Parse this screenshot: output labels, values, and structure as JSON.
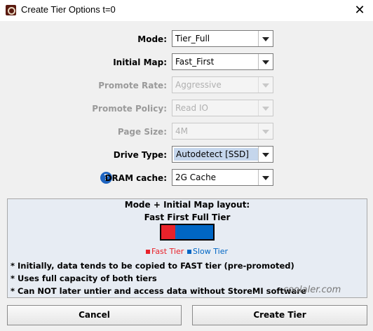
{
  "window": {
    "title": "Create Tier Options t=0",
    "close_glyph": "✕"
  },
  "form": {
    "mode": {
      "label": "Mode:",
      "value": "Tier_Full"
    },
    "initial_map": {
      "label": "Initial Map:",
      "value": "Fast_First"
    },
    "promote_rate": {
      "label": "Promote Rate:",
      "value": "Aggressive"
    },
    "promote_policy": {
      "label": "Promote Policy:",
      "value": "Read IO"
    },
    "page_size": {
      "label": "Page Size:",
      "value": "4M"
    },
    "drive_type": {
      "label": "Drive Type:",
      "value": "Autodetect [SSD]"
    },
    "dram_cache": {
      "label": "DRAM cache:",
      "value": "2G Cache",
      "help_glyph": "?"
    }
  },
  "layout_panel": {
    "heading": "Mode + Initial Map layout:",
    "subheading": "Fast First Full Tier",
    "legend_fast": "Fast Tier",
    "legend_slow": "Slow Tier",
    "notes": [
      "* Initially, data tends to be copied to FAST tier (pre-promoted)",
      "* Uses full capacity of both tiers",
      "* Can NOT later untier and access data without StoreMI software"
    ]
  },
  "buttons": {
    "cancel": "Cancel",
    "create": "Create Tier"
  },
  "colors": {
    "fast_tier": "#e8222a",
    "slow_tier": "#0066c4"
  },
  "watermark": "coolaler.com"
}
